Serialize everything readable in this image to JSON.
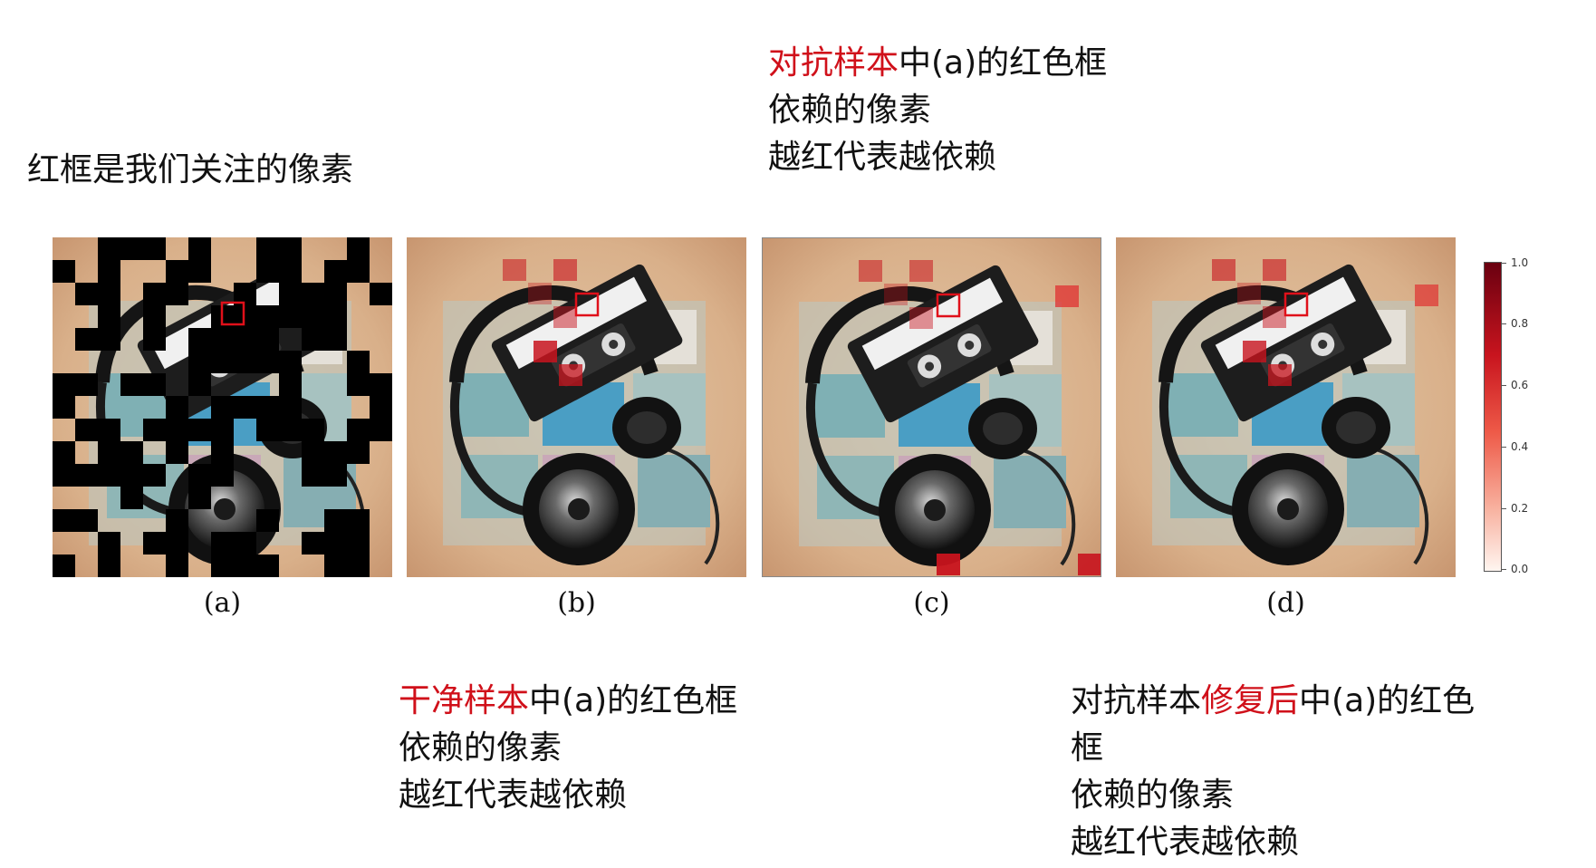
{
  "notes": {
    "a": {
      "line1": "红框是我们关注的像素"
    },
    "c": {
      "hl": "对抗样本",
      "rest": "中(a)的红色框",
      "line2": "依赖的像素",
      "line3": "越红代表越依赖"
    },
    "b": {
      "hl": "干净样本",
      "rest": "中(a)的红色框",
      "line2": "依赖的像素",
      "line3": "越红代表越依赖"
    },
    "d": {
      "pre": "对抗样本",
      "hl": "修复后",
      "rest": "中(a)的红色",
      "line2": "框",
      "line3": "依赖的像素",
      "line4": "越红代表越依赖"
    }
  },
  "captions": [
    "(a)",
    "(b)",
    "(c)",
    "(d)"
  ],
  "colorbar": {
    "ticks": [
      "1.0",
      "0.8",
      "0.6",
      "0.4",
      "0.2",
      "0.0"
    ]
  },
  "colors": {
    "highlight": "#d0101a",
    "heat": "#c8141e"
  }
}
